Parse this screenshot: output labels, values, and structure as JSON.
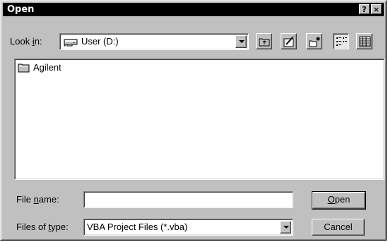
{
  "window": {
    "title": "Open",
    "help_button": "?",
    "close_button": "×"
  },
  "look_in": {
    "label_pre": "Look ",
    "label_accel": "i",
    "label_post": "n:",
    "value": "User (D:)"
  },
  "toolbar": {
    "icons": [
      "up-one-level-icon",
      "desktop-icon",
      "new-folder-icon",
      "list-view-icon",
      "details-view-icon"
    ]
  },
  "files": [
    {
      "name": "Agilent",
      "type": "folder"
    }
  ],
  "file_name": {
    "label_pre": "File ",
    "label_accel": "n",
    "label_post": "ame:",
    "value": ""
  },
  "file_type": {
    "label_pre": "Files of ",
    "label_accel": "t",
    "label_post": "ype:",
    "value": "VBA Project Files (*.vba)"
  },
  "buttons": {
    "open_accel": "O",
    "open_rest": "pen",
    "cancel": "Cancel"
  }
}
